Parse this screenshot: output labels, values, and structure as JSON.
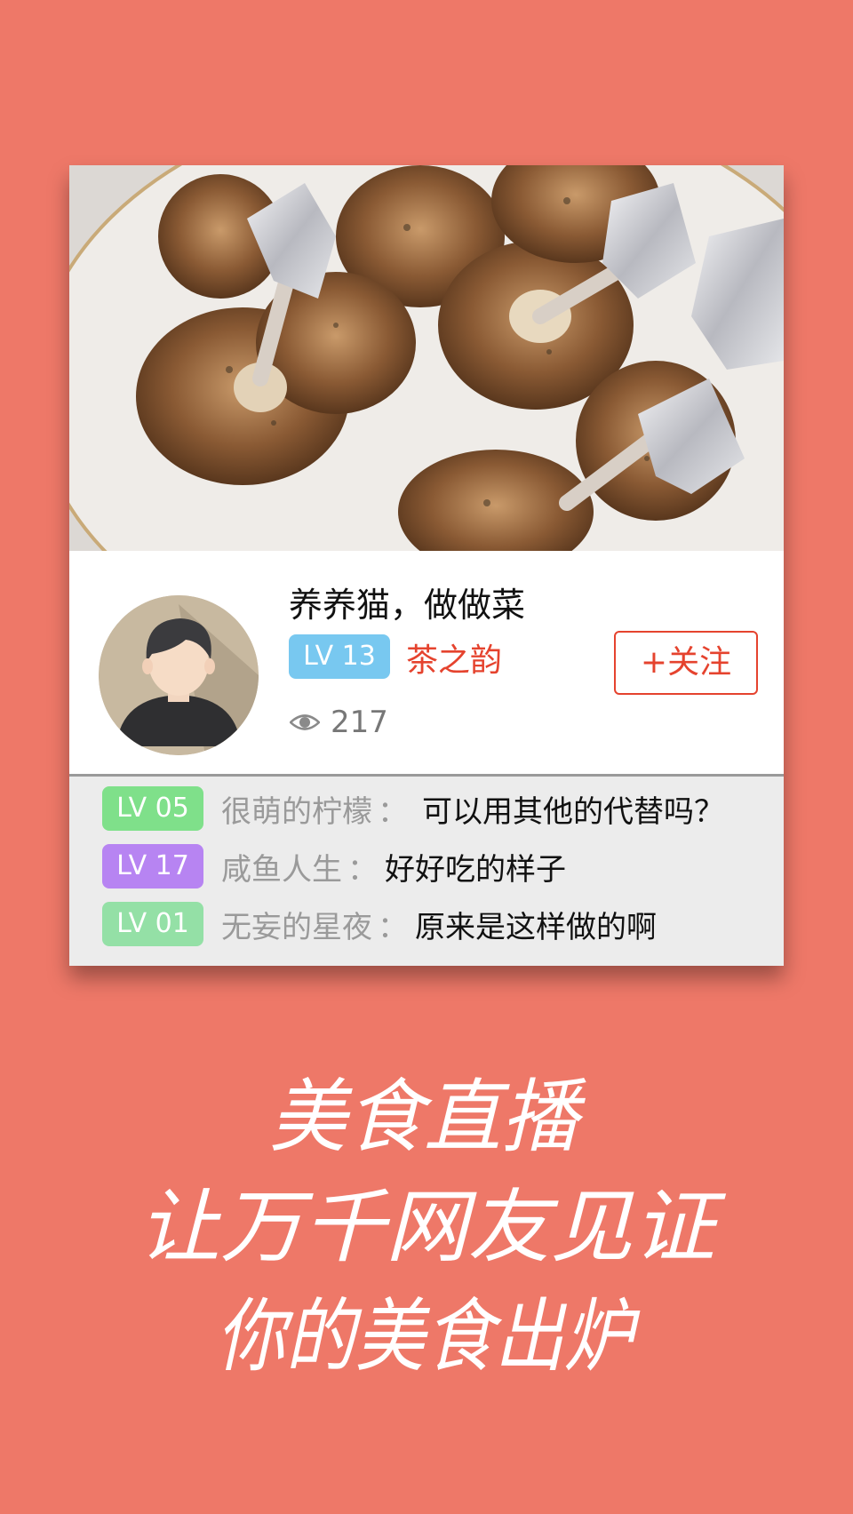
{
  "post": {
    "title": "养养猫，做做菜",
    "author": {
      "level": "LV 13",
      "name": "茶之韵",
      "level_color": "#78c8f0"
    },
    "follow_label": "+关注",
    "views": "217"
  },
  "comments": [
    {
      "level": "LV 05",
      "level_color": "#7fe08a",
      "user": "很萌的柠檬",
      "sep": "：",
      "text": "可以用其他的代替吗？"
    },
    {
      "level": "LV 17",
      "level_color": "#b784f2",
      "user": "咸鱼人生",
      "sep": "：",
      "text": "好好吃的样子"
    },
    {
      "level": "LV 01",
      "level_color": "#94e0a6",
      "user": "无妄的星夜",
      "sep": "：",
      "text": "原来是这样做的啊"
    }
  ],
  "slogan": {
    "line1": "美食直播",
    "line2": "让万千网友见证",
    "line3": "你的美食出炉"
  },
  "colors": {
    "background": "#ee7868",
    "accent_red": "#e5432e",
    "comment_bg": "#ececec"
  },
  "icons": [
    "eye-icon",
    "avatar-icon"
  ]
}
